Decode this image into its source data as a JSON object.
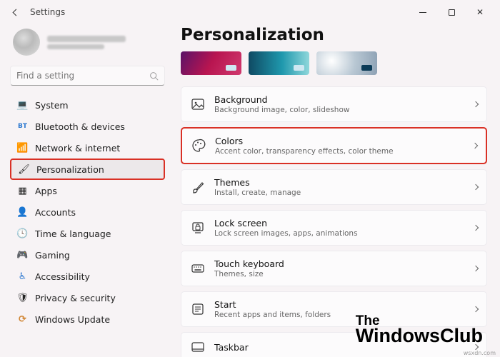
{
  "titlebar": {
    "title": "Settings"
  },
  "search": {
    "placeholder": "Find a setting"
  },
  "nav": [
    {
      "icon": "💻",
      "label": "System"
    },
    {
      "icon": "BT",
      "label": "Bluetooth & devices"
    },
    {
      "icon": "📶",
      "label": "Network & internet"
    },
    {
      "icon": "🖌",
      "label": "Personalization"
    },
    {
      "icon": "▦",
      "label": "Apps"
    },
    {
      "icon": "👤",
      "label": "Accounts"
    },
    {
      "icon": "🕓",
      "label": "Time & language"
    },
    {
      "icon": "🎮",
      "label": "Gaming"
    },
    {
      "icon": "♿",
      "label": "Accessibility"
    },
    {
      "icon": "🛡",
      "label": "Privacy & security"
    },
    {
      "icon": "⟳",
      "label": "Windows Update"
    }
  ],
  "page": {
    "title": "Personalization"
  },
  "settings": [
    {
      "title": "Background",
      "subtitle": "Background image, color, slideshow"
    },
    {
      "title": "Colors",
      "subtitle": "Accent color, transparency effects, color theme"
    },
    {
      "title": "Themes",
      "subtitle": "Install, create, manage"
    },
    {
      "title": "Lock screen",
      "subtitle": "Lock screen images, apps, animations"
    },
    {
      "title": "Touch keyboard",
      "subtitle": "Themes, size"
    },
    {
      "title": "Start",
      "subtitle": "Recent apps and items, folders"
    },
    {
      "title": "Taskbar",
      "subtitle": ""
    }
  ],
  "watermark": {
    "line1": "The",
    "line2": "WindowsClub"
  },
  "credit": "wsxdn.com"
}
